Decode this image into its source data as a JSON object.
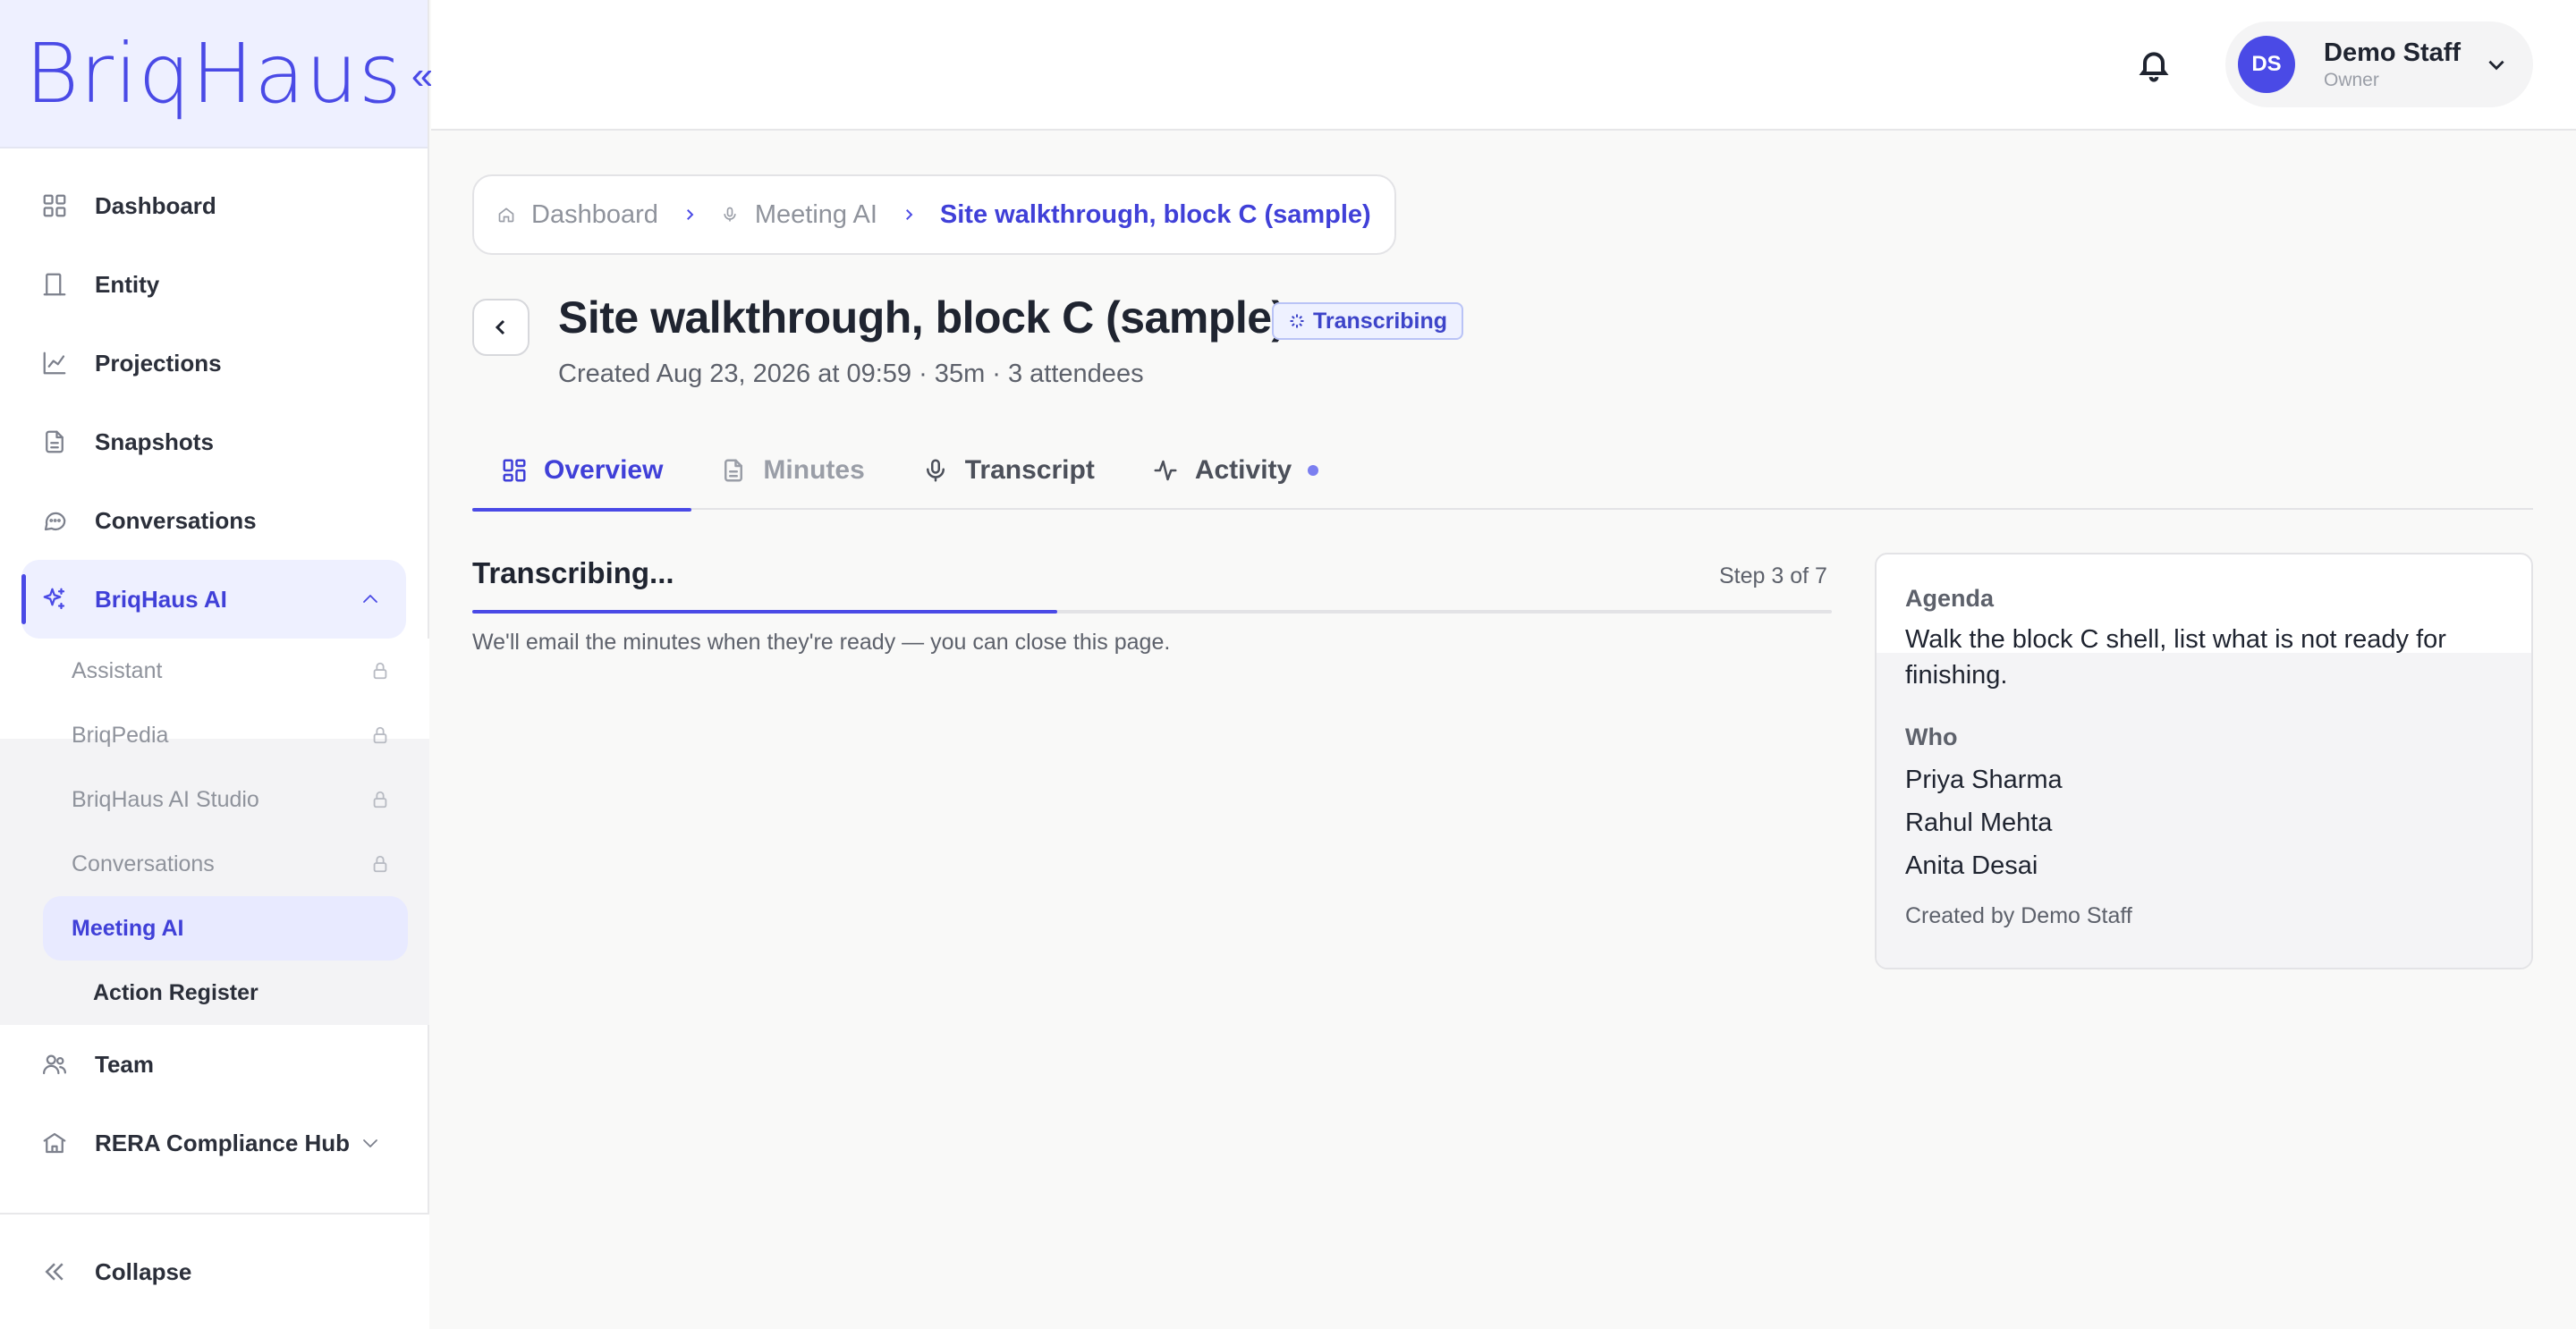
{
  "brand": {
    "name": "BriqHaus",
    "collapse_glyph": "«"
  },
  "sidebar": {
    "items": [
      {
        "label": "Dashboard",
        "icon": "grid-icon"
      },
      {
        "label": "Entity",
        "icon": "building-icon"
      },
      {
        "label": "Projections",
        "icon": "chart-line-icon"
      },
      {
        "label": "Snapshots",
        "icon": "file-icon"
      },
      {
        "label": "Conversations",
        "icon": "chat-bubble-icon"
      },
      {
        "label": "BriqHaus AI",
        "icon": "sparkles-icon"
      }
    ],
    "subitems": [
      {
        "label": "Assistant",
        "locked": true
      },
      {
        "label": "BriqPedia",
        "locked": true
      },
      {
        "label": "BriqHaus AI Studio",
        "locked": true
      },
      {
        "label": "Conversations",
        "locked": true
      },
      {
        "label": "Meeting AI",
        "locked": false
      },
      {
        "label": "Action Register",
        "locked": false
      }
    ],
    "more_items": [
      {
        "label": "Team",
        "icon": "users-icon"
      },
      {
        "label": "RERA Compliance Hub",
        "icon": "landmark-icon"
      }
    ],
    "collapse_label": "Collapse"
  },
  "header": {
    "user": {
      "initials": "DS",
      "name": "Demo Staff",
      "role": "Owner"
    }
  },
  "breadcrumb": [
    {
      "label": "Dashboard"
    },
    {
      "label": "Meeting AI"
    },
    {
      "label": "Site walkthrough, block C (sample)"
    }
  ],
  "meeting": {
    "title": "Site walkthrough, block C (sample)",
    "status": "Transcribing",
    "meta": "Created Aug 23, 2026 at 09:59 · 35m · 3 attendees"
  },
  "tabs": [
    {
      "label": "Overview",
      "icon": "grid-icon"
    },
    {
      "label": "Minutes",
      "icon": "file-icon"
    },
    {
      "label": "Transcript",
      "icon": "microphone-icon"
    },
    {
      "label": "Activity",
      "icon": "activity-icon"
    }
  ],
  "progress": {
    "title": "Transcribing...",
    "step": "Step 3 of 7",
    "fraction": 0.43,
    "note": "We'll email the minutes when they're ready — you can close this page."
  },
  "details": {
    "agenda_label": "Agenda",
    "agenda": "Walk the block C shell, list what is not ready for finishing.",
    "who_label": "Who",
    "attendees": [
      "Priya Sharma",
      "Rahul Mehta",
      "Anita Desai"
    ],
    "created_by": "Created by Demo Staff"
  },
  "colors": {
    "accent": "#4a4ae6",
    "accent_soft": "#eef0ff",
    "badge_border": "#b9c3f6"
  }
}
